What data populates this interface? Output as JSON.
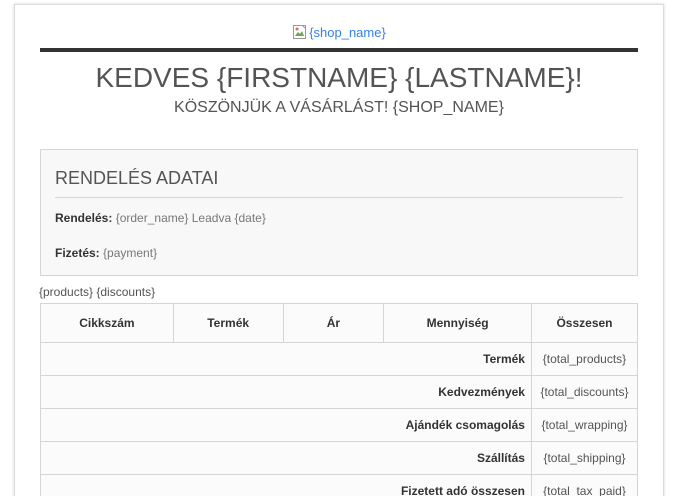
{
  "header": {
    "logo_alt": "{shop_name}",
    "greeting": "KEDVES {FIRSTNAME} {LASTNAME}!",
    "thanks": "KÖSZÖNJÜK A VÁSÁRLÁST! {SHOP_NAME}"
  },
  "order_details": {
    "title": "RENDELÉS ADATAI",
    "order_label": "Rendelés:",
    "order_value": "{order_name} Leadva {date}",
    "payment_label": "Fizetés:",
    "payment_value": "{payment}"
  },
  "products_placeholder": "{products} {discounts}",
  "table": {
    "columns": [
      "Cikkszám",
      "Termék",
      "Ár",
      "Mennyiség",
      "Összesen"
    ],
    "rows": [
      {
        "label": "Termék",
        "value": "{total_products}"
      },
      {
        "label": "Kedvezmények",
        "value": "{total_discounts}"
      },
      {
        "label": "Ajándék csomagolás",
        "value": "{total_wrapping}"
      },
      {
        "label": "Szállítás",
        "value": "{total_shipping}"
      },
      {
        "label": "Fizetett adó összesen",
        "value": "{total_tax_paid}"
      }
    ]
  },
  "colors": {
    "link": "#337ff1",
    "heading": "#555454",
    "rule": "#333333",
    "border": "#d6d4d4",
    "box_bg": "#f8f8f8"
  },
  "icons": {
    "logo": "broken-image-icon"
  }
}
